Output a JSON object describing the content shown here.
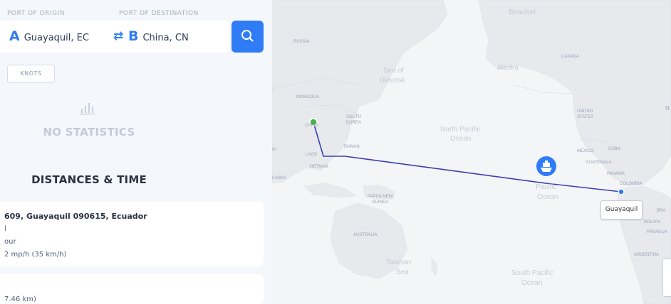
{
  "route_form": {
    "origin_label": "PORT OF ORIGIN",
    "destination_label": "PORT OF DESTINATION",
    "origin_letter": "A",
    "origin_value": "Guayaquil, EC",
    "swap_icon": "swap-icon",
    "destination_letter": "B",
    "destination_value": "China, CN",
    "search_icon": "search-icon"
  },
  "units": {
    "knots_label": "KNOTS"
  },
  "statistics": {
    "empty_icon": "bar-chart-icon",
    "empty_text": "NO STATISTICS"
  },
  "distances": {
    "title": "DISTANCES & TIME",
    "card1": {
      "address": "609, Guayaquil 090615, Ecuador",
      "line1": "l",
      "line2": "our",
      "line3": "2 mp/h (35 km/h)"
    },
    "card2": {
      "line1": "7.46 km)"
    }
  },
  "map": {
    "labels": {
      "russia": "RUSSIA",
      "beaufort": "Beaufort",
      "alaska": "Alaska",
      "canada": "CANADA",
      "sea_okhotsk_1": "Sea of",
      "sea_okhotsk_2": "Okhotsk",
      "mongolia": "MONGOLIA",
      "china": "CHINA",
      "south_korea_1": "SOUTH",
      "south_korea_2": "KOREA",
      "north_pacific_1": "North Pacific",
      "north_pacific_2": "Ocean",
      "united_states_1": "UNITED",
      "united_states_2": "STATES",
      "taiwan": "TAIWAN",
      "laos": "LAOS",
      "vietnam": "VIETNAM",
      "lanka": "LANKA",
      "india_fragment": "IA",
      "mexico": "MEXICO",
      "cuba": "CUBA",
      "guatemala": "GUATEMALA",
      "panama": "PANAMA",
      "colombia": "COLOMBIA",
      "papua_1": "PAPUA NEW",
      "papua_2": "GUINEA",
      "pacific_fragment_1": "Pacific",
      "pacific_fragment_2": "Ocean",
      "australia": "AUSTRALIA",
      "tasman_1": "Tasman",
      "tasman_2": "Sea",
      "south_pacific_1": "South Pacific",
      "south_pacific_2": "Ocean",
      "brazil": "BRA",
      "bolivia": "BOLIVIA",
      "paraguay": "PARAGUA",
      "argentina": "ARGENTINA",
      "n_fragment": "N"
    },
    "tooltip": "Guayaquil",
    "ship_icon": "ship-icon",
    "route_color": "#3a3fb0",
    "origin_marker_color": "#4caf50",
    "destination_marker_color": "#2f7cf6"
  },
  "colors": {
    "accent": "#2f7cf6",
    "panel_bg": "#f4f7fb"
  }
}
